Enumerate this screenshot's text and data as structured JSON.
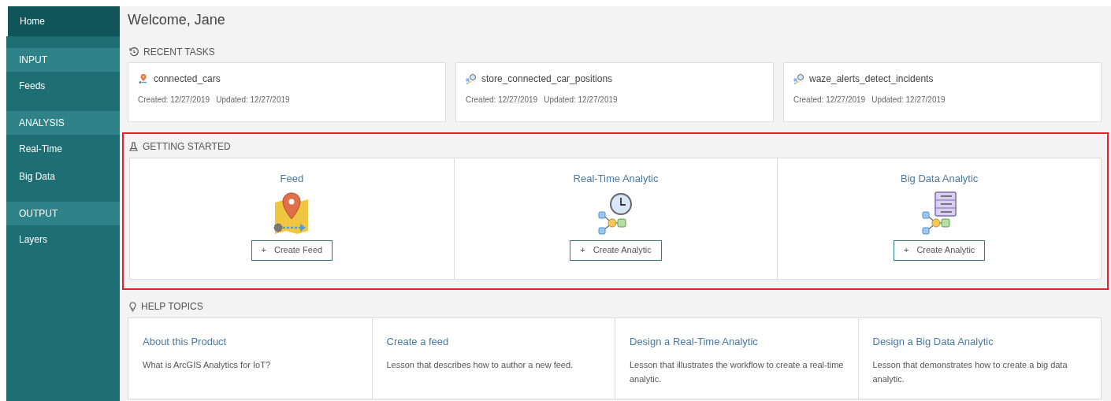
{
  "sidebar": {
    "items": [
      {
        "kind": "item",
        "label": "Home",
        "selected": true
      },
      {
        "kind": "header",
        "label": "INPUT"
      },
      {
        "kind": "item",
        "label": "Feeds",
        "selected": false
      },
      {
        "kind": "header",
        "label": "ANALYSIS"
      },
      {
        "kind": "item",
        "label": "Real-Time",
        "selected": false
      },
      {
        "kind": "item",
        "label": "Big Data",
        "selected": false
      },
      {
        "kind": "header",
        "label": "OUTPUT"
      },
      {
        "kind": "item",
        "label": "Layers",
        "selected": false
      }
    ]
  },
  "page_title": "Welcome, Jane",
  "recent_tasks": {
    "title": "RECENT TASKS",
    "items": [
      {
        "kind": "feed",
        "name": "connected_cars",
        "created": "Created: 12/27/2019",
        "updated": "Updated: 12/27/2019"
      },
      {
        "kind": "analytic",
        "name": "store_connected_car_positions",
        "created": "Created: 12/27/2019",
        "updated": "Updated: 12/27/2019"
      },
      {
        "kind": "analytic",
        "name": "waze_alerts_detect_incidents",
        "created": "Created: 12/27/2019",
        "updated": "Updated: 12/27/2019"
      }
    ]
  },
  "getting_started": {
    "title": "GETTING STARTED",
    "highlighted": true,
    "items": [
      {
        "kind": "feed",
        "title": "Feed",
        "button_icon": "+",
        "button": "Create Feed"
      },
      {
        "kind": "realtime",
        "title": "Real-Time Analytic",
        "button_icon": "+",
        "button": "Create Analytic"
      },
      {
        "kind": "bigdata",
        "title": "Big Data Analytic",
        "button_icon": "+",
        "button": "Create Analytic"
      }
    ]
  },
  "help_topics": {
    "title": "HELP TOPICS",
    "items": [
      {
        "title": "About this Product",
        "text": "What is ArcGIS Analytics for IoT?"
      },
      {
        "title": "Create a feed",
        "text": "Lesson that describes how to author a new feed."
      },
      {
        "title": "Design a Real-Time Analytic",
        "text": "Lesson that illustrates the workflow to create a real-time analytic."
      },
      {
        "title": "Design a Big Data Analytic",
        "text": "Lesson that demonstrates how to create a big data analytic."
      }
    ]
  }
}
